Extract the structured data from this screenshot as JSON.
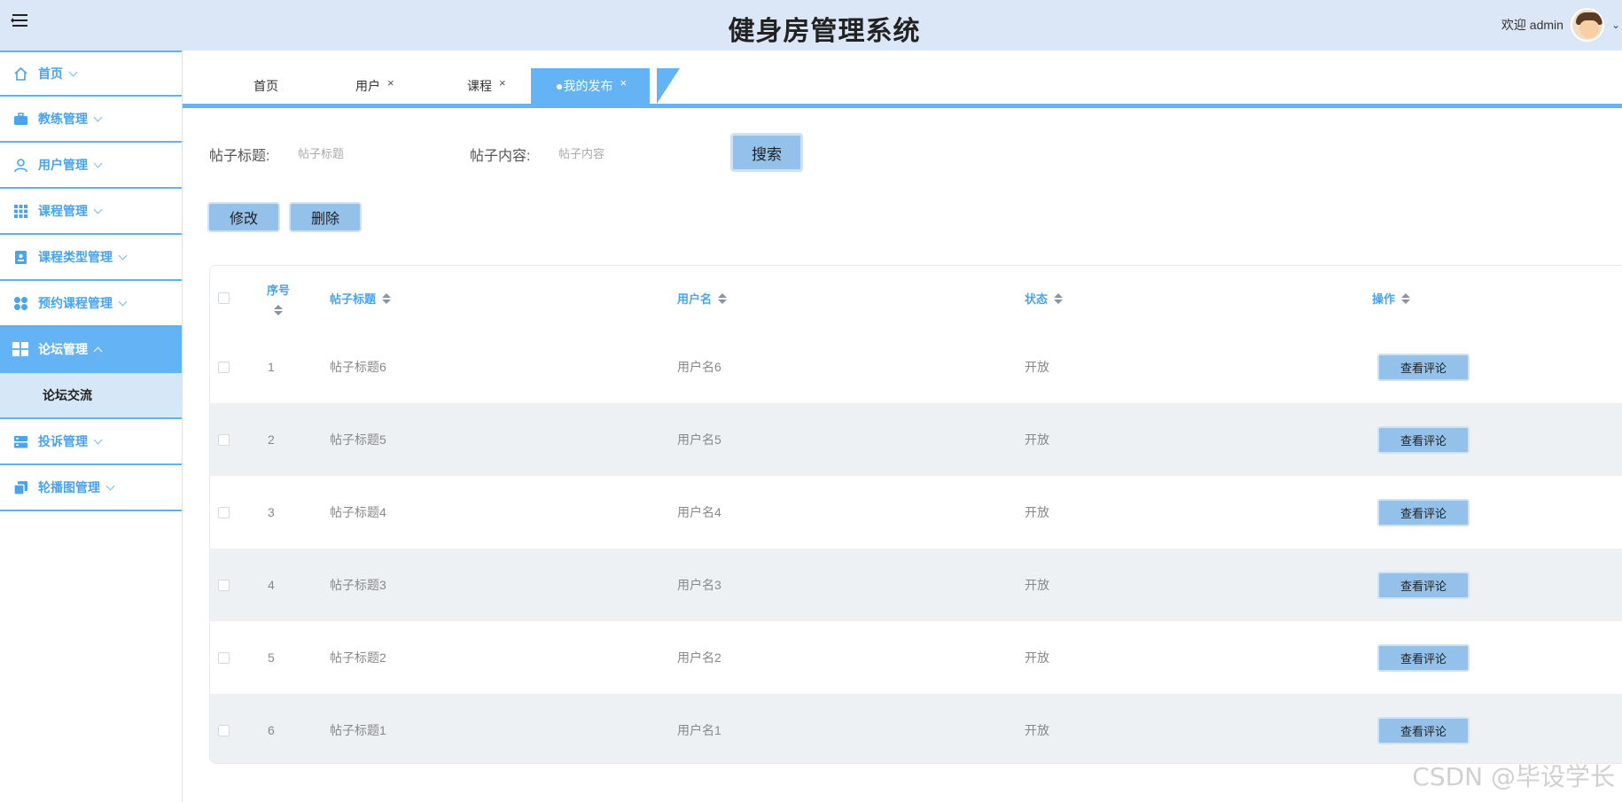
{
  "header": {
    "title": "健身房管理系统",
    "welcome": "欢迎 admin"
  },
  "sidebar": {
    "items": [
      {
        "label": "首页",
        "icon": "home-icon"
      },
      {
        "label": "教练管理",
        "icon": "briefcase-icon"
      },
      {
        "label": "用户管理",
        "icon": "user-icon"
      },
      {
        "label": "课程管理",
        "icon": "grid-icon"
      },
      {
        "label": "课程类型管理",
        "icon": "badge-icon"
      },
      {
        "label": "预约课程管理",
        "icon": "flower-icon"
      },
      {
        "label": "论坛管理",
        "icon": "layout-icon",
        "active": true
      },
      {
        "label": "投诉管理",
        "icon": "server-icon"
      },
      {
        "label": "轮播图管理",
        "icon": "copy-icon"
      }
    ],
    "sub_item": "论坛交流"
  },
  "tabs": [
    {
      "label": "首页"
    },
    {
      "label": "用户",
      "close": "×"
    },
    {
      "label": "课程",
      "close": "×"
    },
    {
      "label": "●我的发布",
      "close": "×",
      "active": true
    }
  ],
  "search": {
    "title_label": "帖子标题:",
    "title_placeholder": "帖子标题",
    "content_label": "帖子内容:",
    "content_placeholder": "帖子内容",
    "button": "搜索"
  },
  "actions": {
    "edit": "修改",
    "delete": "删除"
  },
  "table": {
    "columns": [
      "序号",
      "帖子标题",
      "用户名",
      "状态",
      "操作"
    ],
    "rows": [
      {
        "no": "1",
        "title": "帖子标题6",
        "user": "用户名6",
        "status": "开放",
        "action": "查看评论"
      },
      {
        "no": "2",
        "title": "帖子标题5",
        "user": "用户名5",
        "status": "开放",
        "action": "查看评论"
      },
      {
        "no": "3",
        "title": "帖子标题4",
        "user": "用户名4",
        "status": "开放",
        "action": "查看评论"
      },
      {
        "no": "4",
        "title": "帖子标题3",
        "user": "用户名3",
        "status": "开放",
        "action": "查看评论"
      },
      {
        "no": "5",
        "title": "帖子标题2",
        "user": "用户名2",
        "status": "开放",
        "action": "查看评论"
      },
      {
        "no": "6",
        "title": "帖子标题1",
        "user": "用户名1",
        "status": "开放",
        "action": "查看评论"
      }
    ]
  },
  "watermark": "CSDN @毕设学长",
  "colors": {
    "header_bg": "#dbe7f6",
    "accent": "#64b3f4",
    "sidebar_text": "#4aa3ec",
    "button_bg": "#94c1ea",
    "row_alt": "#eef1f4"
  }
}
